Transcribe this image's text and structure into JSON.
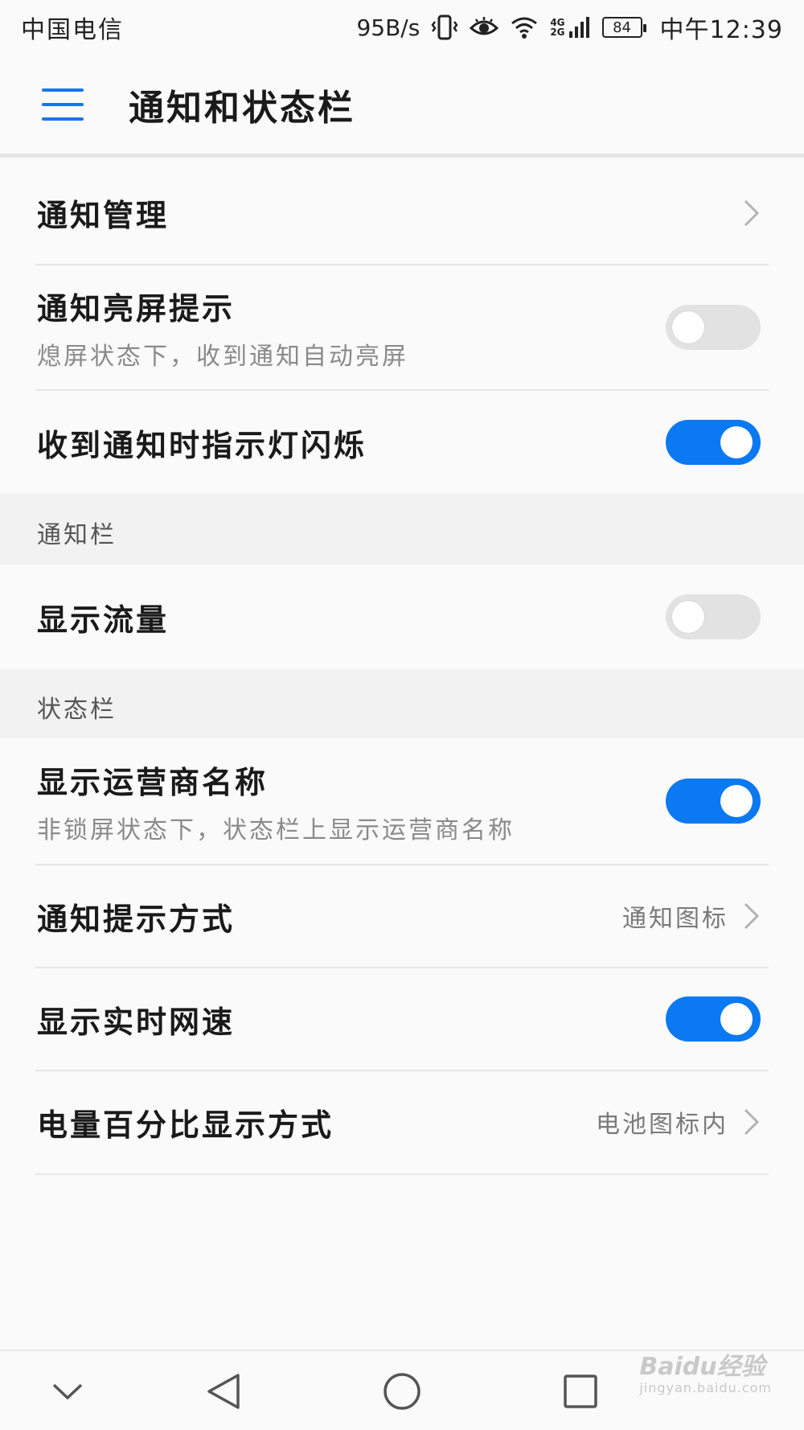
{
  "status_bar": {
    "carrier": "中国电信",
    "net_speed": "95B/s",
    "net_type_top": "4G",
    "net_type_bottom": "2G",
    "battery": "84",
    "time": "中午12:39"
  },
  "app_bar": {
    "title": "通知和状态栏"
  },
  "rows": {
    "notification_management": {
      "title": "通知管理"
    },
    "screen_wake": {
      "title": "通知亮屏提示",
      "subtitle": "熄屏状态下，收到通知自动亮屏",
      "enabled": false
    },
    "led_blink": {
      "title": "收到通知时指示灯闪烁",
      "enabled": true
    }
  },
  "sections": {
    "notification_bar": "通知栏",
    "status_bar": "状态栏"
  },
  "notification_bar_rows": {
    "show_traffic": {
      "title": "显示流量",
      "enabled": false
    }
  },
  "status_bar_rows": {
    "carrier_name": {
      "title": "显示运营商名称",
      "subtitle": "非锁屏状态下，状态栏上显示运营商名称",
      "enabled": true
    },
    "notify_style": {
      "title": "通知提示方式",
      "value": "通知图标"
    },
    "realtime_speed": {
      "title": "显示实时网速",
      "enabled": true
    },
    "battery_percent": {
      "title": "电量百分比显示方式",
      "value": "电池图标内"
    }
  },
  "watermark": {
    "brand": "Baidu经验",
    "url": "jingyan.baidu.com"
  },
  "colors": {
    "accent": "#0a79f2",
    "toggle_off": "#e2e2e2"
  }
}
